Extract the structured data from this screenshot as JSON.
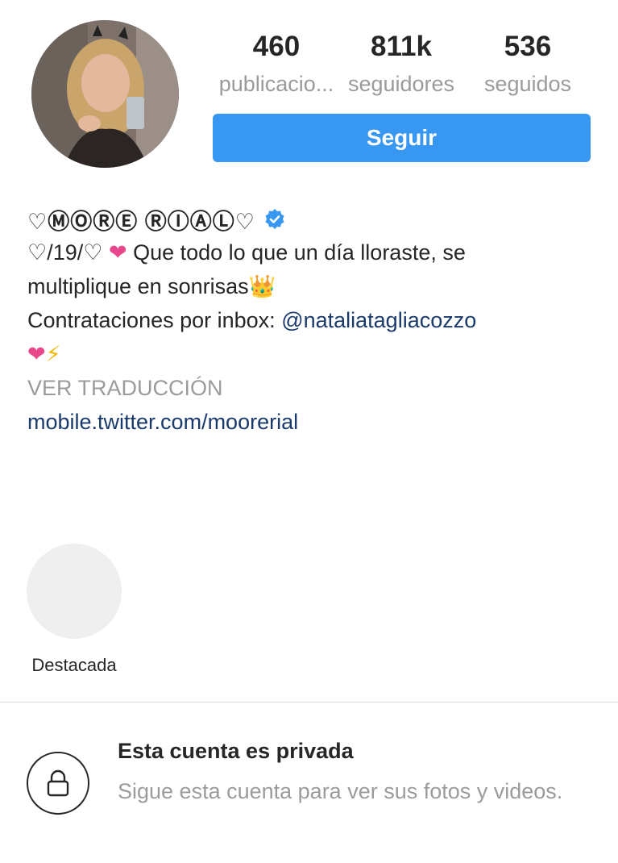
{
  "profile": {
    "stats": [
      {
        "value": "460",
        "label": "publicacio..."
      },
      {
        "value": "811k",
        "label": "seguidores"
      },
      {
        "value": "536",
        "label": "seguidos"
      }
    ],
    "follow_label": "Seguir",
    "display_name": "♡ⓂⓄⓇⒺ ⓇⒾⒶⓁ♡",
    "bio": {
      "line1": "♡/19/♡ ",
      "line1_heart": "❤",
      "line1_rest": " Que todo lo que un día lloraste, se",
      "line2": "multiplique en sonrisas👑",
      "line3_prefix": "Contrataciones por inbox:  ",
      "line3_mention": "@nataliatagliacozzo",
      "line4_heart": "❤",
      "line4_bolt": "⚡"
    },
    "translate_label": "VER TRADUCCIÓN",
    "link": "mobile.twitter.com/moorerial"
  },
  "highlight": {
    "label": "Destacada"
  },
  "private": {
    "title": "Esta cuenta es privada",
    "description": "Sigue esta cuenta para ver sus fotos y videos."
  },
  "colors": {
    "accent": "#3897f0",
    "mention": "#1a3a6b",
    "muted": "#9b9b9b",
    "heart": "#e8478b"
  }
}
